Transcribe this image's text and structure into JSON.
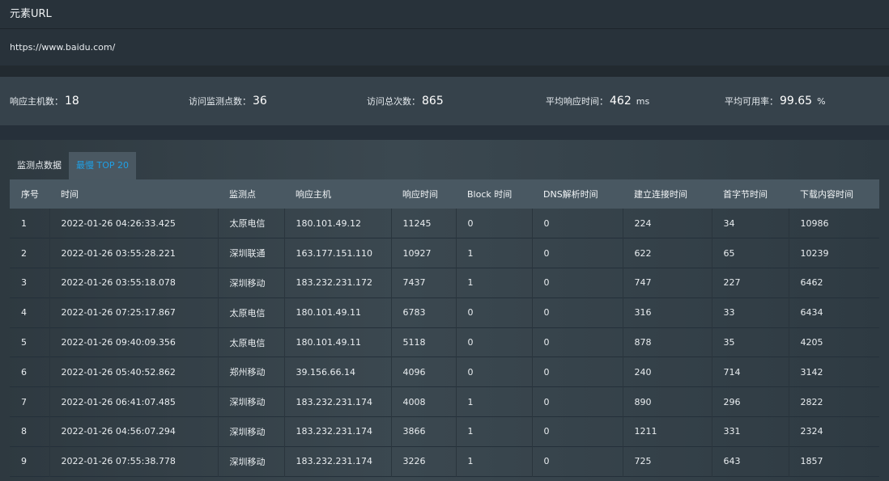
{
  "header": {
    "title": "元素URL",
    "url": "https://www.baidu.com/"
  },
  "stats": {
    "hosts_label": "响应主机数：",
    "hosts_value": "18",
    "points_label": "访问监测点数：",
    "points_value": "36",
    "visits_label": "访问总次数：",
    "visits_value": "865",
    "avg_resp_label": "平均响应时间：",
    "avg_resp_value": "462",
    "avg_resp_unit": "ms",
    "avail_label": "平均可用率：",
    "avail_value": "99.65",
    "avail_unit": "%"
  },
  "tabs": [
    {
      "label": "监测点数据",
      "active": false
    },
    {
      "label": "最慢 TOP 20",
      "active": true
    }
  ],
  "table": {
    "columns": [
      "序号",
      "时间",
      "监测点",
      "响应主机",
      "响应时间",
      "Block 时间",
      "DNS解析时间",
      "建立连接时间",
      "首字节时间",
      "下载内容时间"
    ],
    "rows": [
      [
        "1",
        "2022-01-26 04:26:33.425",
        "太原电信",
        "180.101.49.12",
        "11245",
        "0",
        "0",
        "224",
        "34",
        "10986"
      ],
      [
        "2",
        "2022-01-26 03:55:28.221",
        "深圳联通",
        "163.177.151.110",
        "10927",
        "1",
        "0",
        "622",
        "65",
        "10239"
      ],
      [
        "3",
        "2022-01-26 03:55:18.078",
        "深圳移动",
        "183.232.231.172",
        "7437",
        "1",
        "0",
        "747",
        "227",
        "6462"
      ],
      [
        "4",
        "2022-01-26 07:25:17.867",
        "太原电信",
        "180.101.49.11",
        "6783",
        "0",
        "0",
        "316",
        "33",
        "6434"
      ],
      [
        "5",
        "2022-01-26 09:40:09.356",
        "太原电信",
        "180.101.49.11",
        "5118",
        "0",
        "0",
        "878",
        "35",
        "4205"
      ],
      [
        "6",
        "2022-01-26 05:40:52.862",
        "郑州移动",
        "39.156.66.14",
        "4096",
        "0",
        "0",
        "240",
        "714",
        "3142"
      ],
      [
        "7",
        "2022-01-26 06:41:07.485",
        "深圳移动",
        "183.232.231.174",
        "4008",
        "1",
        "0",
        "890",
        "296",
        "2822"
      ],
      [
        "8",
        "2022-01-26 04:56:07.294",
        "深圳移动",
        "183.232.231.174",
        "3866",
        "1",
        "0",
        "1211",
        "331",
        "2324"
      ],
      [
        "9",
        "2022-01-26 07:55:38.778",
        "深圳移动",
        "183.232.231.174",
        "3226",
        "1",
        "0",
        "725",
        "643",
        "1857"
      ]
    ]
  },
  "colors": {
    "accent": "#1ea0e6",
    "background": "#2c373f",
    "table_header": "#495862"
  }
}
